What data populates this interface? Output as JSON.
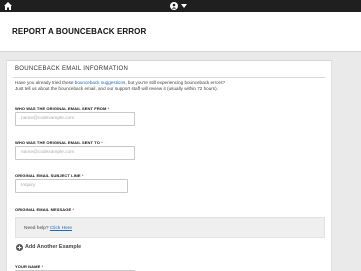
{
  "header": {
    "title": "REPORT A BOUNCEBACK ERROR"
  },
  "form": {
    "section_title": "BOUNCEBACK EMAIL INFORMATION",
    "intro": {
      "line1_prefix": "Have you already tried these ",
      "link": "bounceback suggestions",
      "line1_suffix": ", but you're still experiencing bounceback errors?",
      "line2": "Just tell us about the bounceback email, and our support staff will review it (usually within 72 hours)."
    },
    "fields": {
      "sent_from": {
        "label": "WHO WAS THE ORIGINAL EMAIL SENT FROM",
        "required": "*",
        "placeholder": "name@codexample.com"
      },
      "sent_to": {
        "label": "WHO WAS THE ORIGINAL EMAIL SENT TO",
        "required": "*",
        "placeholder": "name@codexample.com"
      },
      "subject": {
        "label": "ORIGINAL EMAIL SUBJECT LINE",
        "required": "*",
        "placeholder": "Inquiry"
      },
      "message": {
        "label": "ORIGINAL EMAIL MESSAGE",
        "required": "*"
      },
      "your_name": {
        "label": "YOUR NAME",
        "required": "*"
      }
    },
    "help": {
      "prefix": "Need help? ",
      "link": "Click Here"
    },
    "add_another": "Add Another Example"
  },
  "icons": {
    "home": "home-icon",
    "user": "user-icon",
    "caret": "caret-down-icon",
    "add": "plus-circle-icon"
  }
}
